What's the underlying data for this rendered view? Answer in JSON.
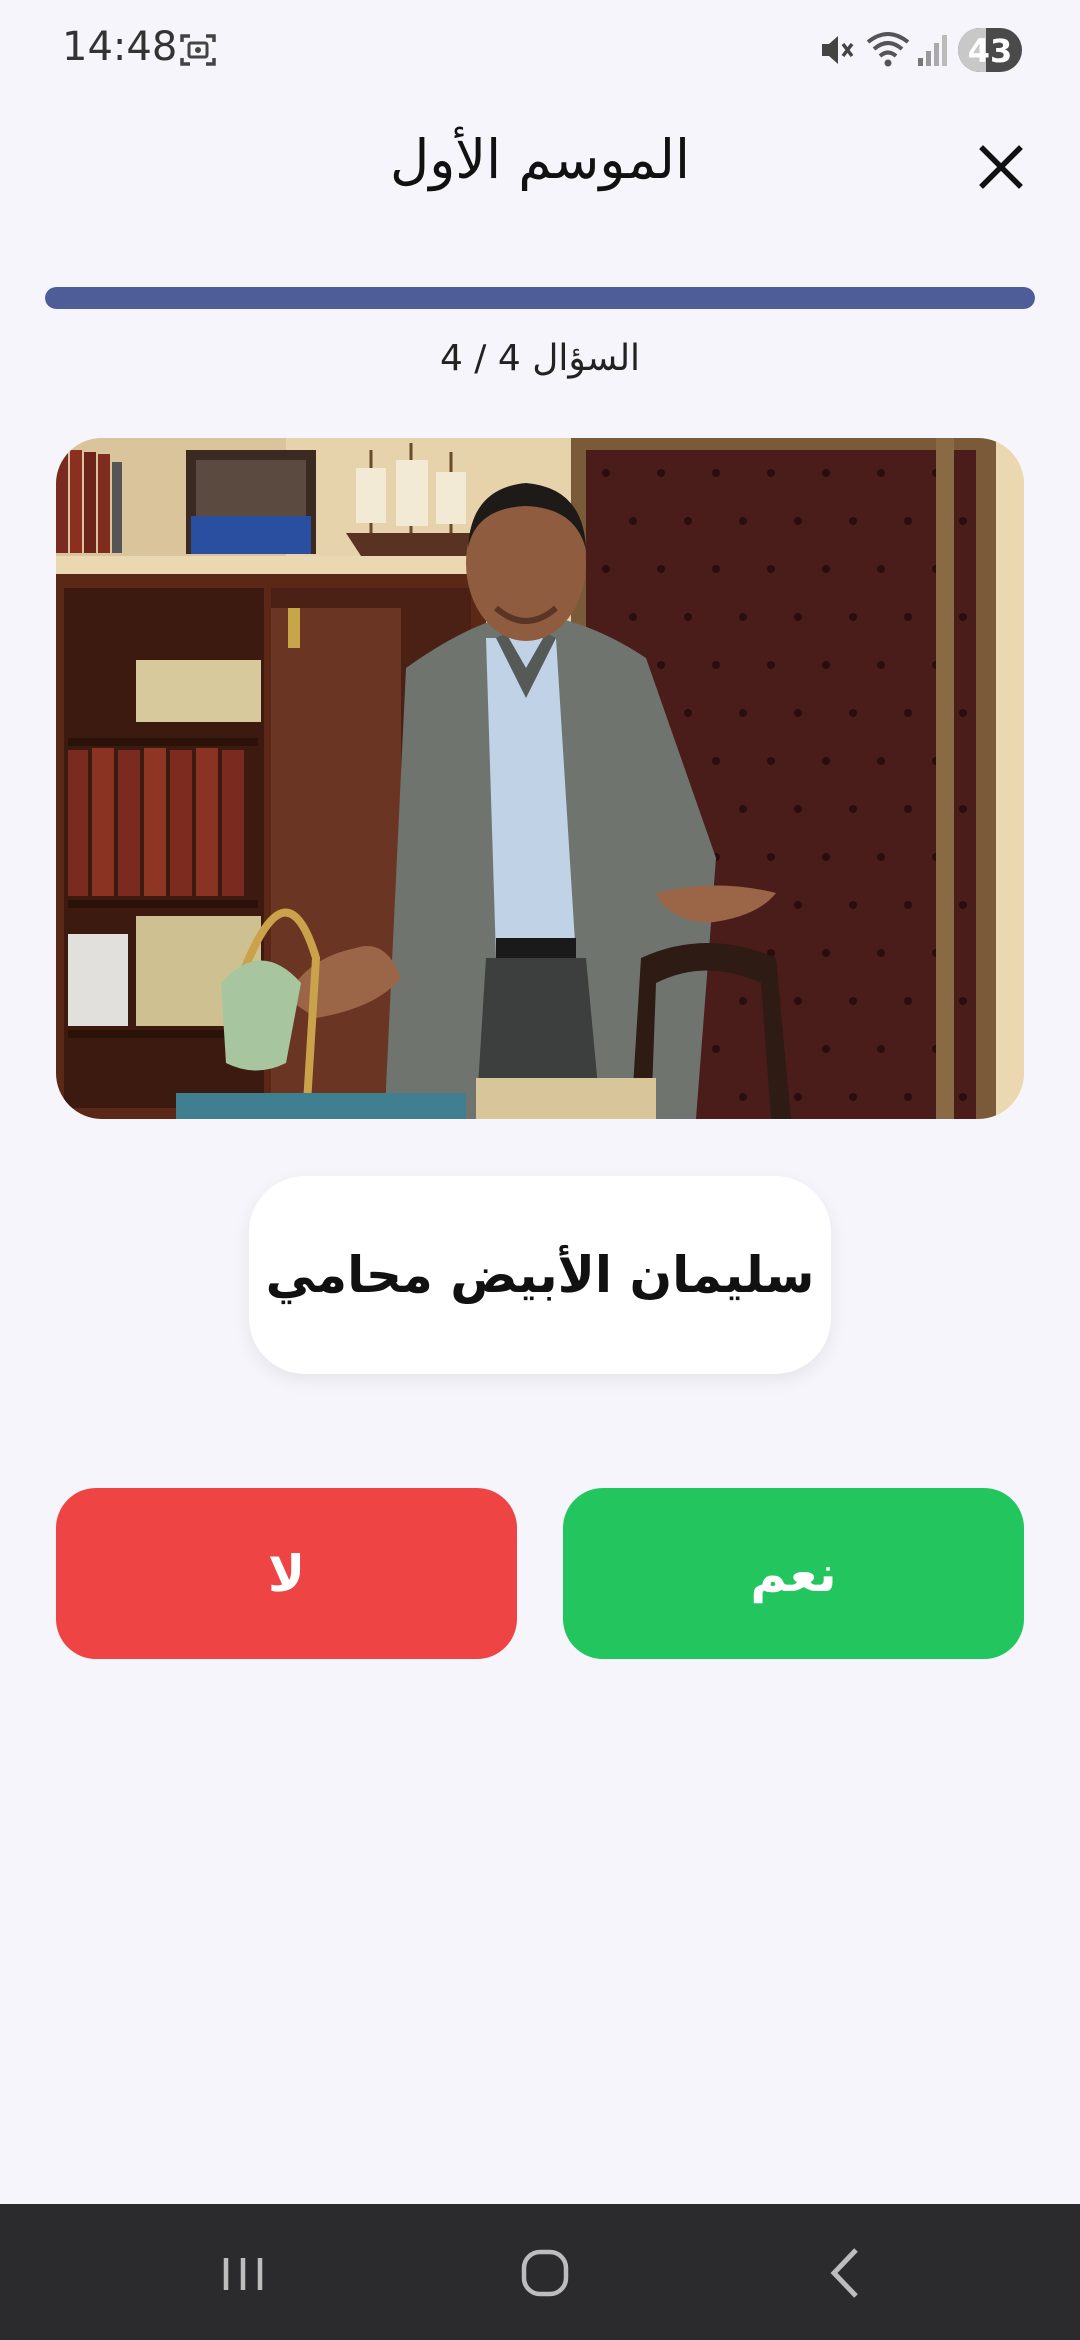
{
  "status_bar": {
    "time": "14:48",
    "battery": "43",
    "battery_level": 0.43,
    "icons": [
      "screen-record-icon",
      "mute-icon",
      "wifi-icon",
      "signal-icon"
    ]
  },
  "header": {
    "title": "الموسم الأول",
    "close_icon": "close-icon"
  },
  "progress": {
    "label": "السؤال 4 / 4",
    "fraction": 1.0
  },
  "question": {
    "image": "tv-series-scene-man-in-office",
    "statement": "سليمان الأبيض محامي"
  },
  "answers": {
    "yes_label": "نعم",
    "no_label": "لا"
  },
  "nav_bar": {
    "icons": [
      "recent-apps-icon",
      "home-icon",
      "back-icon"
    ]
  },
  "colors": {
    "background": "#f6f5fb",
    "progress": "#4e5d97",
    "yes": "#22c55e",
    "no": "#ef4444",
    "nav_bar": "#2b2b2d"
  }
}
